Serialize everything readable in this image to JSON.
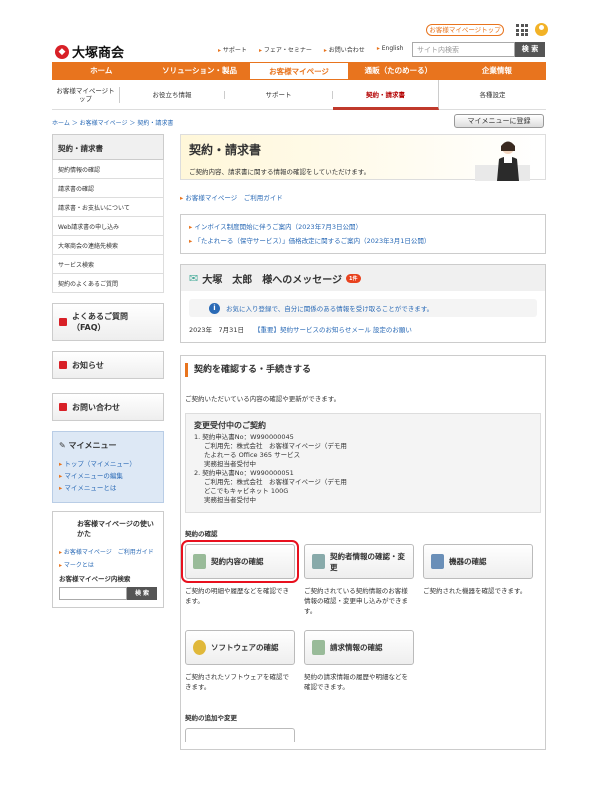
{
  "top": {
    "mypage_button": "お客様マイページトップ"
  },
  "header": {
    "logo": "大塚商会",
    "util_links": [
      "サポート",
      "フェア・セミナー",
      "お問い合わせ",
      "English"
    ],
    "search_placeholder": "サイト内検索",
    "search_button": "検 索"
  },
  "gnav": [
    "ホーム",
    "ソリューション・製品",
    "お客様マイページ",
    "通販（たのめーる）",
    "企業情報"
  ],
  "subnav": [
    "お客様マイページトップ",
    "お役立ち情報",
    "サポート",
    "契約・請求書",
    "各種設定"
  ],
  "breadcrumb": "ホーム ＞ お客様マイページ ＞ 契約・請求書",
  "register_button": "マイメニューに登録",
  "sidebar": {
    "title": "契約・請求書",
    "links": [
      "契約情報の確認",
      "請求書の確認",
      "請求書・お支払いについて",
      "Web請求書の申し込み",
      "大塚商会の連絡先検索",
      "サービス検索",
      "契約のよくあるご質問"
    ],
    "faq": "よくあるご質問（FAQ）",
    "news": "お知らせ",
    "contact": "お問い合わせ",
    "my_menu": {
      "title": "マイメニュー",
      "links": [
        "トップ（マイメニュー）",
        "マイメニューの編集",
        "マイメニューとは"
      ]
    },
    "guide": {
      "title": "お客様マイページの使いかた",
      "links": [
        "お客様マイページ　ご利用ガイド",
        "マークとは"
      ],
      "search_label": "お客様マイページ内検索",
      "search_button": "検 索"
    }
  },
  "main": {
    "title": "契約・請求書",
    "subtitle": "ご契約内容、請求書に関する情報の確認をしていただけます。",
    "guide_link": "お客様マイページ　ご利用ガイド",
    "notices": [
      "インボイス制度開始に伴うご案内（2023年7月3日公開）",
      "「たよれーる（保守サービス）」価格改定に関するご案内（2023年3月1日公開）"
    ],
    "message": {
      "heading": "大塚　太郎　様へのメッセージ",
      "badge": "1件",
      "info": "お気に入り登録で、自分に関係のある情報を受け取ることができます。",
      "date": "2023年　7月31日",
      "link": "【重要】契約サービスのお知らせメール 設定のお願い"
    },
    "section": {
      "title": "契約を確認する・手続きする",
      "desc": "ご契約いただいている内容の確認や更新ができます。"
    },
    "changes": {
      "title": "変更受付中のご契約",
      "items": [
        [
          "1. 契約申込書No：W990000045",
          "ご利用先：株式会社　お客様マイページ（デモ用",
          "たよれーる Office 365 サービス",
          "実務担当者受付中"
        ],
        [
          "2. 契約申込書No：W990000051",
          "ご利用先：株式会社　お客様マイページ（デモ用",
          "どこでもキャビネット 100G",
          "実務担当者受付中"
        ]
      ]
    },
    "category1": "契約の確認",
    "cards": [
      {
        "label": "契約内容の確認",
        "desc": "ご契約の明細や履歴などを確認できます。"
      },
      {
        "label": "契約者情報の確認・変更",
        "desc": "ご契約されている契約情報のお客様情報の確認・変更申し込みができます。"
      },
      {
        "label": "機器の確認",
        "desc": "ご契約された機器を確認できます。"
      },
      {
        "label": "ソフトウェアの確認",
        "desc": "ご契約されたソフトウェアを確認できます。"
      },
      {
        "label": "請求情報の確認",
        "desc": "契約の請求情報の履歴や明細などを確認できます。"
      }
    ],
    "category2": "契約の追加や変更"
  },
  "colors": {
    "accent": "#e8741e",
    "link": "#2a6ab6",
    "highlight": "#e8101e"
  }
}
